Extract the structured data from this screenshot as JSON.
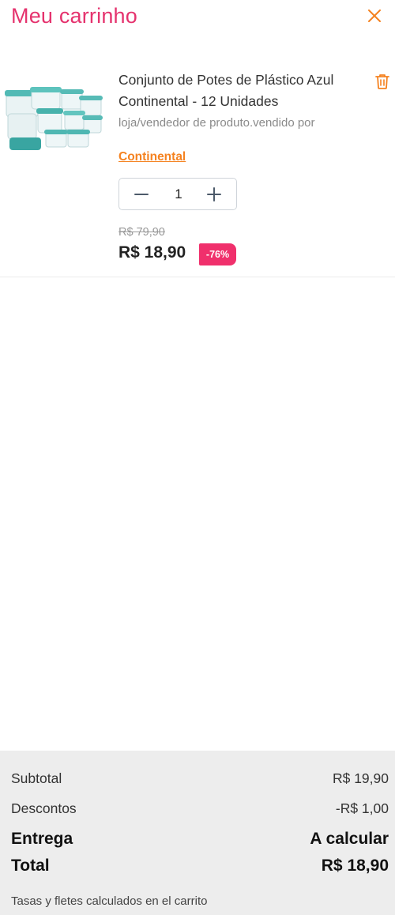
{
  "header": {
    "title": "Meu carrinho",
    "close_icon": "close-icon"
  },
  "cart": {
    "items": [
      {
        "name": "Conjunto de Potes de Plástico Azul Continental - 12 Unidades",
        "seller_prefix": "loja/vendedor de produto.vendido por",
        "seller": "Continental",
        "quantity": "1",
        "old_price": "R$ 79,90",
        "price": "R$ 18,90",
        "discount_badge": "-76%"
      }
    ]
  },
  "summary": {
    "subtotal_label": "Subtotal",
    "subtotal_value": "R$ 19,90",
    "discounts_label": "Descontos",
    "discounts_value": "-R$ 1,00",
    "shipping_label": "Entrega",
    "shipping_value": "A calcular",
    "total_label": "Total",
    "total_value": "R$ 18,90",
    "note": "Tasas y fletes calculados en el carrito"
  },
  "colors": {
    "title": "#e5336e",
    "accent_orange": "#f58220",
    "badge": "#f0306c",
    "summary_bg": "#ededed"
  }
}
